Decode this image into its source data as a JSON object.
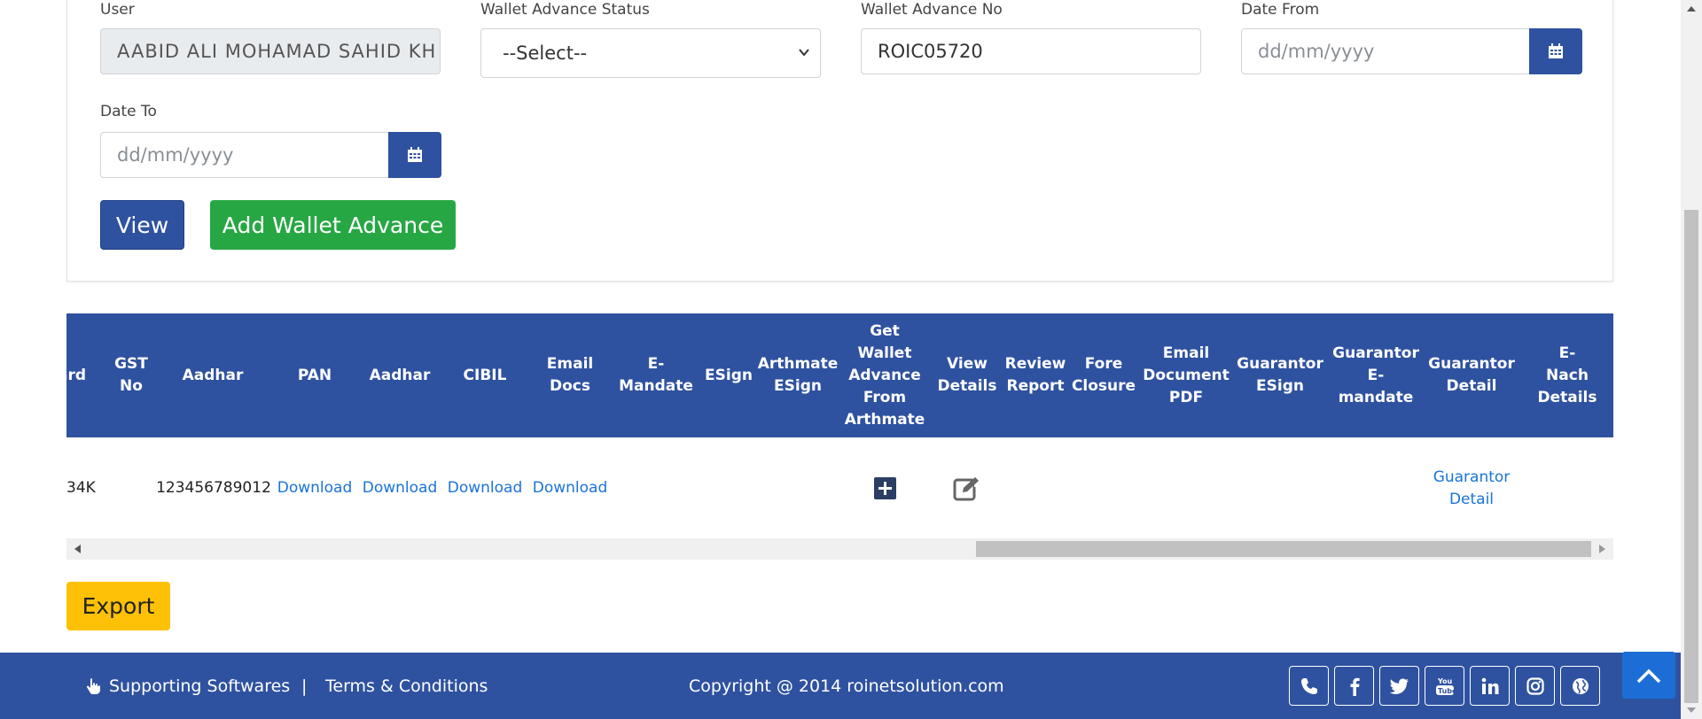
{
  "filters": {
    "user_label": "User",
    "user_value": "AABID ALI MOHAMAD  SAHID KH",
    "status_label": "Wallet Advance Status",
    "status_value": "--Select--",
    "wallet_no_label": "Wallet Advance No",
    "wallet_no_value": "ROIC05720",
    "date_from_label": "Date From",
    "date_from_placeholder": "dd/mm/yyyy",
    "date_to_label": "Date To",
    "date_to_placeholder": "dd/mm/yyyy"
  },
  "buttons": {
    "view": "View",
    "add_wallet_advance": "Add Wallet Advance",
    "export": "Export"
  },
  "table": {
    "headers": [
      "ard",
      "GST\nNo",
      "Aadhar",
      "PAN",
      "Aadhar",
      "CIBIL",
      "Email\nDocs",
      "E-\nMandate",
      "ESign",
      "Arthmate\nESign",
      "Get\nWallet\nAdvance\nFrom\nArthmate",
      "View\nDetails",
      "Review\nReport",
      "Fore\nClosure",
      "Email\nDocument\nPDF",
      "Guarantor\nESign",
      "Guarantor\nE-\nmandate",
      "Guarantor\nDetail",
      "E-\nNach\nDetails"
    ],
    "row": {
      "card": "34K",
      "gst_no": "",
      "aadhar": "123456789012",
      "pan": "Download",
      "aadhar_doc": "Download",
      "cibil": "Download",
      "email_docs": "Download",
      "guarantor_detail": "Guarantor\nDetail"
    }
  },
  "scroll": {
    "table_horizontal_fraction": 0.6,
    "page_vertical_fraction": 0.7
  },
  "footer": {
    "supporting_softwares": "Supporting Softwares",
    "separator": "|",
    "terms": "Terms & Conditions",
    "copyright": "Copyright @ 2014 roinetsolution.com",
    "social_icons": [
      "phone-icon",
      "facebook-icon",
      "twitter-icon",
      "youtube-icon",
      "linkedin-icon",
      "instagram-icon",
      "globe-icon"
    ]
  },
  "colors": {
    "primary": "#2f52a0",
    "success": "#27a744",
    "warning": "#ffc107",
    "link": "#1a73d9"
  }
}
